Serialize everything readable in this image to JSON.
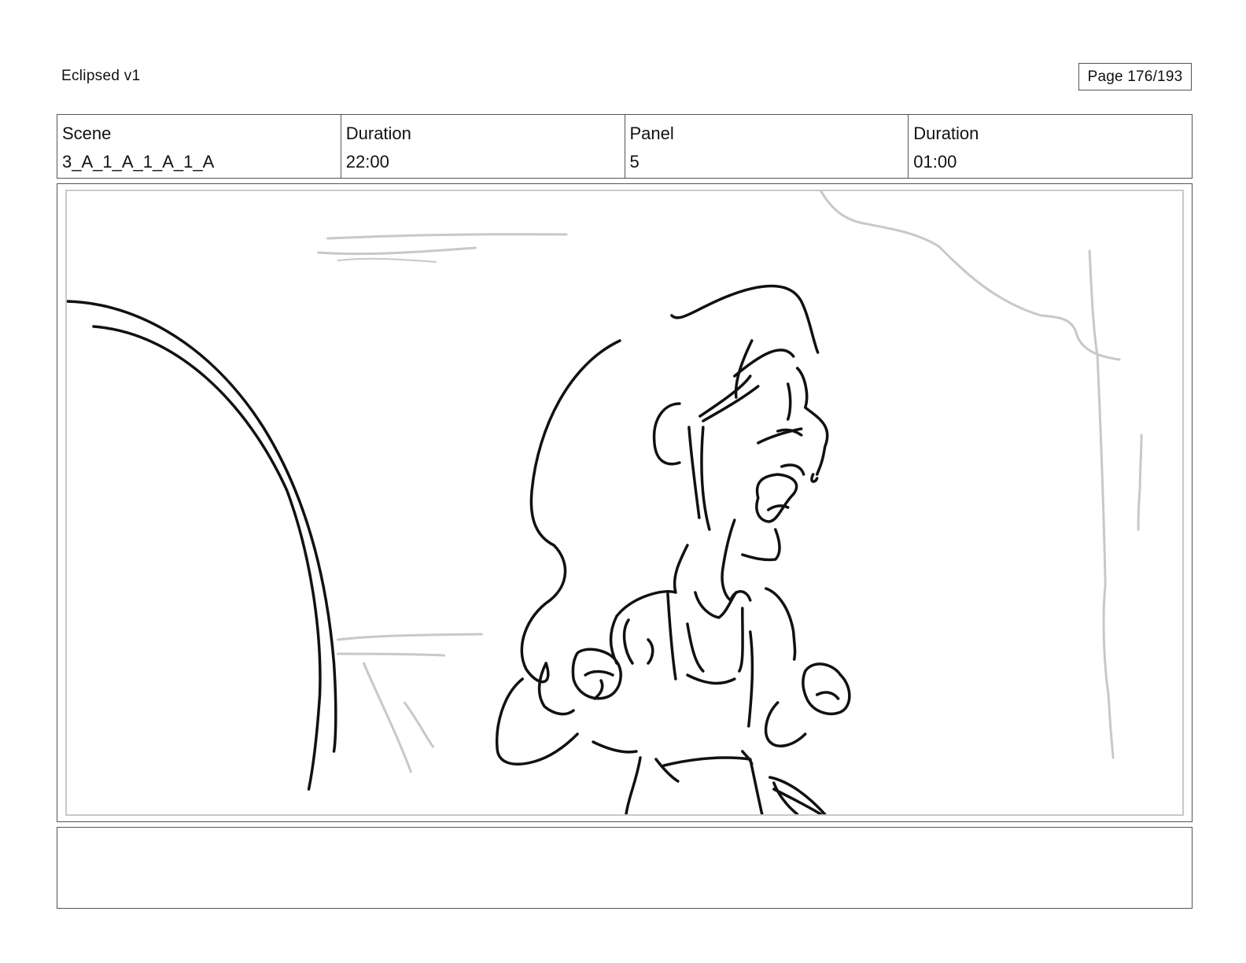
{
  "header": {
    "project_title": "Eclipsed v1",
    "page_label": "Page 176/193"
  },
  "info": {
    "scene_label": "Scene",
    "scene_value": "3_A_1_A_1_A_1_A",
    "duration_label": "Duration",
    "duration_value": "22:00",
    "panel_label": "Panel",
    "panel_value": "5",
    "panel_duration_label": "Duration",
    "panel_duration_value": "01:00"
  },
  "notes": {
    "text": ""
  },
  "colors": {
    "ink": "#111111",
    "sketch_gray": "#c8c8c8",
    "border": "#555555"
  }
}
